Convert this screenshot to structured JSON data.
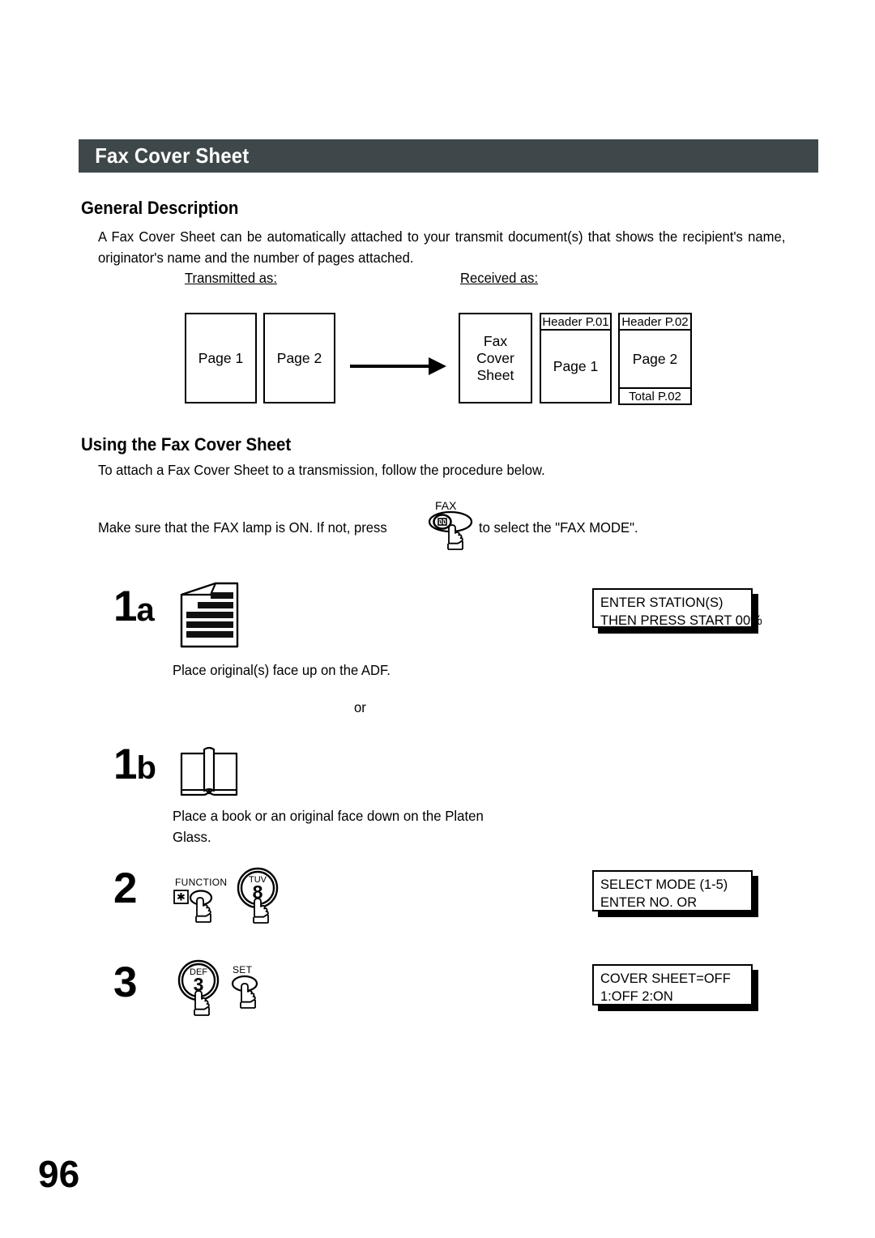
{
  "header": {
    "title": "Fax Cover Sheet"
  },
  "sections": {
    "general": {
      "heading": "General Description",
      "paragraph": "A Fax Cover Sheet can be automatically attached to your transmit document(s) that shows the recipient's name, originator's name and the number of pages attached."
    },
    "using": {
      "heading": "Using the Fax Cover Sheet",
      "intro": "To attach a Fax Cover Sheet to a transmission, follow the procedure below.",
      "lamp_text_before": "Make sure that the FAX lamp is ON.  If not, press",
      "lamp_text_after": "to select the \"FAX MODE\"."
    }
  },
  "diagram": {
    "transmitted_label": "Transmitted as:",
    "received_label": "Received as:",
    "transmitted_pages": [
      "Page 1",
      "Page 2"
    ],
    "received": {
      "cover": "Fax\nCover\nSheet",
      "cover_lines": [
        "Fax",
        "Cover",
        "Sheet"
      ],
      "pages": [
        {
          "header": "Header P.01",
          "body": "Page 1",
          "footer": ""
        },
        {
          "header": "Header P.02",
          "body": "Page 2",
          "footer": "Total P.02"
        }
      ]
    }
  },
  "steps": [
    {
      "number": "1",
      "suffix": "a",
      "icon": "document-stack-icon",
      "caption": "Place original(s) face up on the ADF.",
      "lcd": [
        "ENTER STATION(S)",
        "THEN PRESS START 00%"
      ]
    },
    {
      "number": "1",
      "suffix": "b",
      "icon": "open-book-icon",
      "caption": "Place a book or an original face down on the Platen Glass.",
      "lcd": []
    },
    {
      "number": "2",
      "suffix": "",
      "keys": [
        {
          "label": "FUNCTION",
          "glyph": "*",
          "shape": "oval"
        },
        {
          "label": "TUV",
          "glyph": "8",
          "shape": "round"
        }
      ],
      "lcd": [
        "SELECT MODE   (1-5)",
        "ENTER NO. OR"
      ]
    },
    {
      "number": "3",
      "suffix": "",
      "keys": [
        {
          "label": "DEF",
          "glyph": "3",
          "shape": "round"
        },
        {
          "label": "SET",
          "glyph": "",
          "shape": "oval"
        }
      ],
      "lcd": [
        "COVER SHEET=OFF",
        "1:OFF 2:ON"
      ]
    }
  ],
  "or_text": "or",
  "fax_key": {
    "label": "FAX",
    "glyph": "fax-machine-icon"
  },
  "page_number": "96",
  "colors": {
    "header_bar": "#3e4749",
    "text": "#000000",
    "paper": "#ffffff"
  }
}
